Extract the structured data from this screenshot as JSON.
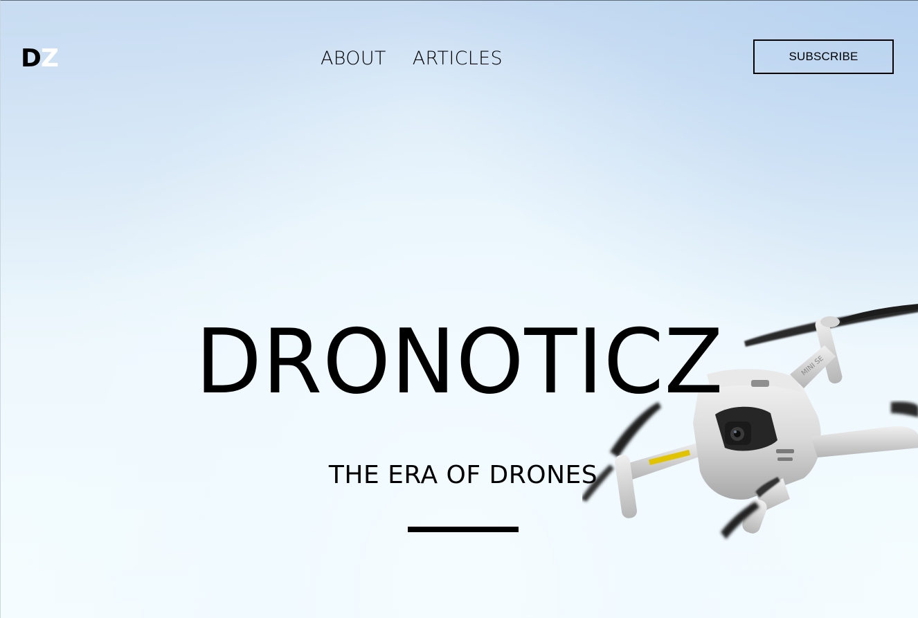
{
  "header": {
    "logo": {
      "letter1": "D",
      "letter2": "Z"
    },
    "nav": [
      {
        "label": "ABOUT"
      },
      {
        "label": "ARTICLES"
      }
    ],
    "subscribe_label": "SUBSCRIBE"
  },
  "hero": {
    "title": "DRONOTICZ",
    "tagline": "THE ERA OF DRONES",
    "drone_model_text": "MINI SE"
  },
  "colors": {
    "text": "#000000",
    "logo_accent": "#ffffff",
    "sky_top": "#c8dcf2",
    "sky_bottom": "#f5fcff"
  },
  "icons": {
    "hero_image": "drone-image"
  }
}
